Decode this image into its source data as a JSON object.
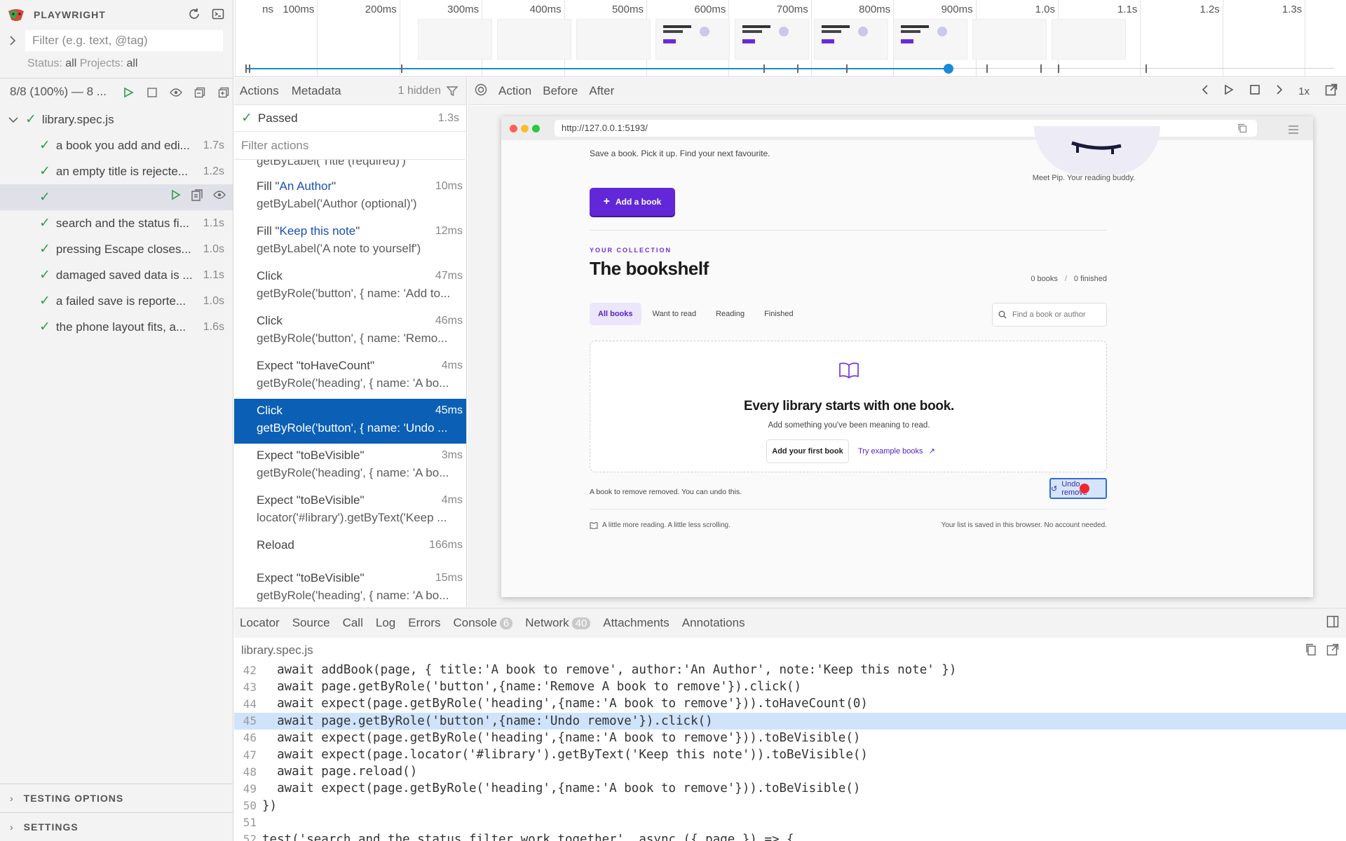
{
  "app": {
    "title": "PLAYWRIGHT"
  },
  "sidebar": {
    "filter_placeholder": "Filter (e.g. text, @tag)",
    "status_label": "Status:",
    "status_value": "all",
    "projects_label": "Projects:",
    "projects_value": "all",
    "run_summary": "8/8 (100%) — 8 ...",
    "file": "library.spec.js",
    "tests": [
      {
        "title": "a book you add and edi...",
        "duration": "1.7s"
      },
      {
        "title": "an empty title is rejecte...",
        "duration": "1.2s"
      },
      {
        "title": "",
        "duration": ""
      },
      {
        "title": "search and the status fi...",
        "duration": "1.1s"
      },
      {
        "title": "pressing Escape closes...",
        "duration": "1.0s"
      },
      {
        "title": "damaged saved data is ...",
        "duration": "1.1s"
      },
      {
        "title": "a failed save is reporte...",
        "duration": "1.0s"
      },
      {
        "title": "the phone layout fits, a...",
        "duration": "1.6s"
      }
    ],
    "testing_options": "TESTING OPTIONS",
    "settings": "SETTINGS"
  },
  "timeline": {
    "ticks": [
      "ns",
      "100ms",
      "200ms",
      "300ms",
      "400ms",
      "500ms",
      "600ms",
      "700ms",
      "800ms",
      "900ms",
      "1.0s",
      "1.1s",
      "1.2s",
      "1.3s"
    ]
  },
  "actions_panel": {
    "tabs": [
      "Actions",
      "Metadata"
    ],
    "hidden": "1 hidden",
    "passed": "Passed",
    "passed_duration": "1.3s",
    "filter_placeholder": "Filter actions",
    "top_partial": "getByLabel('Title (required)')",
    "items": [
      {
        "pre": "Fill \"",
        "q": "An Author",
        "post": "\"",
        "sub": "getByLabel('Author (optional)')",
        "dur": "10ms"
      },
      {
        "pre": "Fill \"",
        "q": "Keep this note",
        "post": "\"",
        "sub": "getByLabel('A note to yourself')",
        "dur": "12ms"
      },
      {
        "pre": "Click",
        "q": "",
        "post": "",
        "sub": "getByRole('button', { name: 'Add to...",
        "dur": "47ms"
      },
      {
        "pre": "Click",
        "q": "",
        "post": "",
        "sub": "getByRole('button', { name: 'Remo...",
        "dur": "46ms"
      },
      {
        "pre": "Expect \"toHaveCount\"",
        "q": "",
        "post": "",
        "sub": "getByRole('heading', { name: 'A bo...",
        "dur": "4ms"
      },
      {
        "pre": "Click",
        "q": "",
        "post": "",
        "sub": "getByRole('button', { name: 'Undo ...",
        "dur": "45ms"
      },
      {
        "pre": "Expect \"toBeVisible\"",
        "q": "",
        "post": "",
        "sub": "getByRole('heading', { name: 'A bo...",
        "dur": "3ms"
      },
      {
        "pre": "Expect \"toBeVisible\"",
        "q": "",
        "post": "",
        "sub": "locator('#library').getByText('Keep ...",
        "dur": "4ms"
      },
      {
        "pre": "Reload",
        "q": "",
        "post": "",
        "sub": "",
        "dur": "166ms"
      },
      {
        "pre": "Expect \"toBeVisible\"",
        "q": "",
        "post": "",
        "sub": "getByRole('heading', { name: 'A bo...",
        "dur": "15ms"
      }
    ]
  },
  "snapshot": {
    "tabs": [
      "Action",
      "Before",
      "After"
    ],
    "speed": "1x",
    "url": "http://127.0.0.1:5193/",
    "page": {
      "tagline": "Save a book. Pick it up. Find your next favourite.",
      "mascot_caption": "Meet Pip. Your reading buddy.",
      "add_button": "Add a book",
      "eyebrow": "YOUR COLLECTION",
      "title": "The bookshelf",
      "count_books": "0 books",
      "count_finished": "0 finished",
      "pills": [
        "All books",
        "Want to read",
        "Reading",
        "Finished"
      ],
      "search_placeholder": "Find a book or author",
      "empty_title": "Every library starts with one book.",
      "empty_sub": "Add something you've been meaning to read.",
      "first_button": "Add your first book",
      "example_link": "Try example books",
      "toast": "A book to remove removed. You can undo this.",
      "undo_button": "Undo remove",
      "footer_left": "A little more reading. A little less scrolling.",
      "footer_right": "Your list is saved in this browser. No account needed."
    }
  },
  "bottom_panel": {
    "tabs": [
      "Locator",
      "Source",
      "Call",
      "Log",
      "Errors",
      "Console",
      "Network",
      "Attachments",
      "Annotations"
    ],
    "console_count": "6",
    "network_count": "40",
    "file": "library.spec.js"
  },
  "code": [
    {
      "n": "42",
      "t": "  await addBook(page, { title:'A book to remove', author:'An Author', note:'Keep this note' })"
    },
    {
      "n": "43",
      "t": "  await page.getByRole('button',{name:'Remove A book to remove'}).click()"
    },
    {
      "n": "44",
      "t": "  await expect(page.getByRole('heading',{name:'A book to remove'})).toHaveCount(0)"
    },
    {
      "n": "45",
      "t": "  await page.getByRole('button',{name:'Undo remove'}).click()"
    },
    {
      "n": "46",
      "t": "  await expect(page.getByRole('heading',{name:'A book to remove'})).toBeVisible()"
    },
    {
      "n": "47",
      "t": "  await expect(page.locator('#library').getByText('Keep this note')).toBeVisible()"
    },
    {
      "n": "48",
      "t": "  await page.reload()"
    },
    {
      "n": "49",
      "t": "  await expect(page.getByRole('heading',{name:'A book to remove'})).toBeVisible()"
    },
    {
      "n": "50",
      "t": "})"
    },
    {
      "n": "51",
      "t": ""
    },
    {
      "n": "52",
      "t": "test('search and the status filter work together', async ({ page }) => {"
    }
  ],
  "colors": {
    "accent": "#6227d6",
    "selection": "#0b5fb5",
    "pass": "#2e9d4a",
    "timeline": "#1a8bd6"
  }
}
